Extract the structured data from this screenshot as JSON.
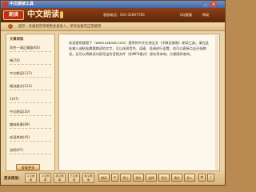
{
  "window": {
    "title": "中文朗读工具"
  },
  "header": {
    "logo_badge": "朗读",
    "logo_text": "中文朗读",
    "info": "客服电话：010-52897785",
    "link_qq": "QQ客服",
    "link_help": "帮助"
  },
  "toolbar": {
    "tip": "提示：升级后可享受更多发音人，所有功能可正常使用"
  },
  "sidebar": {
    "title": "文章阅读",
    "items": [
      {
        "label": "同性一调正确路(60)"
      },
      {
        "label": "畅(76)"
      },
      {
        "label": "中文朗读(137)"
      },
      {
        "label": "精选美文(122)"
      },
      {
        "label": "1(47)"
      },
      {
        "label": "中文朗读(20)"
      },
      {
        "label": "趣味故事(89)"
      },
      {
        "label": "成语典故(45)"
      },
      {
        "label": "说明(97)"
      }
    ],
    "more_label": "查看更多"
  },
  "editor": {
    "content": "欢迎使用搜狐下（www.xxbook.com）提供的中文在线全文（字数无限制）朗读工具。请在此处输入或粘贴需要朗读的文字，可以选择音色、语速、语调进行设置，也可以直接点击开始朗读。还可以将朗读内容导出为音频文件（如MP3格式）保存到本地，方便随时收听。"
  },
  "bottom": {
    "more_label": "更多朗读：",
    "features": [
      {
        "label": "中文朗读"
      },
      {
        "label": "中文朗读"
      },
      {
        "label": "英文朗读"
      },
      {
        "label": "日文朗读"
      },
      {
        "label": "韩文朗读"
      }
    ],
    "controls": [
      {
        "label": "朗读"
      },
      {
        "label": "暂停"
      },
      {
        "label": "停止"
      },
      {
        "label": "保存"
      },
      {
        "label": "选择"
      },
      {
        "label": "导出"
      },
      {
        "label": "清空"
      },
      {
        "label": "导入"
      }
    ]
  }
}
